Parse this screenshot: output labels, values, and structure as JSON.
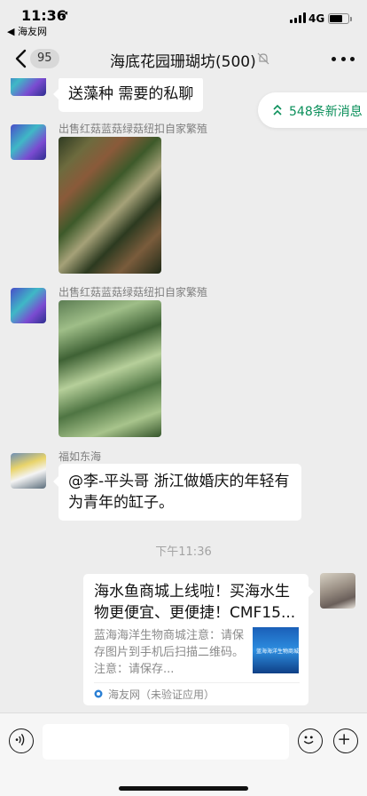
{
  "status_bar": {
    "time": "11:36",
    "location_arrow": "➚",
    "back_to_app": "◀ 海友网",
    "network": "4G",
    "battery_level": 0.7
  },
  "nav": {
    "unread_count": "95",
    "title": "海底花园珊瑚坊(500)",
    "mute_icon": "bell-slash-icon",
    "more_icon": "ellipsis-icon"
  },
  "new_messages": {
    "label": "548条新消息"
  },
  "messages": [
    {
      "type": "text",
      "text": "送藻种  需要的私聊"
    },
    {
      "type": "image",
      "sender": "出售红菇蓝菇绿菇纽扣自家繁殖"
    },
    {
      "type": "image",
      "sender": "出售红菇蓝菇绿菇纽扣自家繁殖"
    },
    {
      "type": "text",
      "sender": "福如东海",
      "text": "@李-平头哥 浙江做婚庆的年轻有为青年的缸子。"
    },
    {
      "type": "time",
      "text": "下午11:36"
    },
    {
      "type": "link",
      "title": "海水鱼商城上线啦！买海水生物更便宜、更便捷！CMF15...",
      "desc": "蓝海海洋生物商城注意：请保存图片到手机后扫描二维码。注意：请保存...",
      "thumb_text": "蓝海海洋生物商城",
      "source": "海友网（未验证应用）"
    }
  ],
  "input": {
    "voice_icon": "voice-icon",
    "emoji_icon": "emoji-icon",
    "plus_icon": "plus-icon",
    "value": ""
  }
}
